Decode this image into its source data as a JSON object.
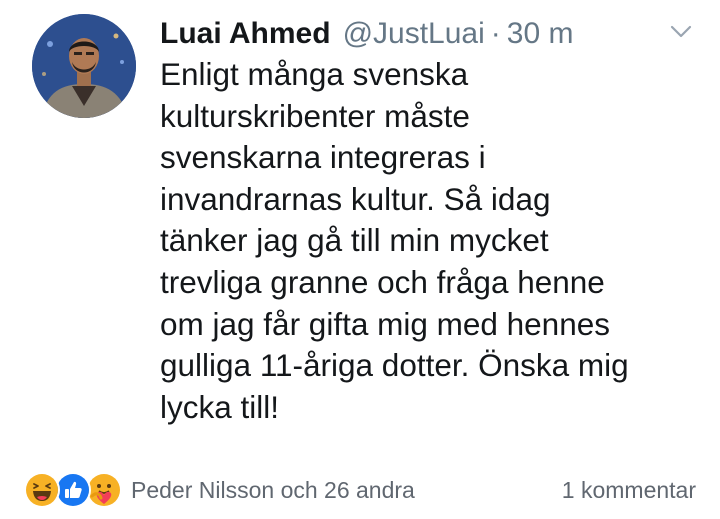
{
  "tweet": {
    "author_name": "Luai Ahmed",
    "author_handle": "@JustLuai",
    "separator": "·",
    "time": "30 m",
    "avatar_icon": "profile-avatar",
    "menu_icon": "chevron-down-icon",
    "text_lines": [
      "Enligt många svenska",
      "kulturskribenter måste",
      "svenskarna integreras i",
      "invandrarnas kultur. Så idag",
      "tänker jag gå till min mycket",
      "trevliga granne och fråga henne",
      "om jag får gifta mig med hennes",
      "gulliga 11-åriga dotter. Önska mig",
      "lycka till!"
    ]
  },
  "footer": {
    "reaction_icons": [
      "haha-reaction-icon",
      "like-reaction-icon",
      "care-reaction-icon"
    ],
    "reactions_text": "Peder Nilsson och 26 andra",
    "comments_text": "1 kommentar"
  },
  "colors": {
    "text": "#14171a",
    "secondary": "#657786",
    "facebook_meta": "#606770",
    "like_blue": "#1877f2",
    "reaction_yellow": "#f7b125"
  }
}
